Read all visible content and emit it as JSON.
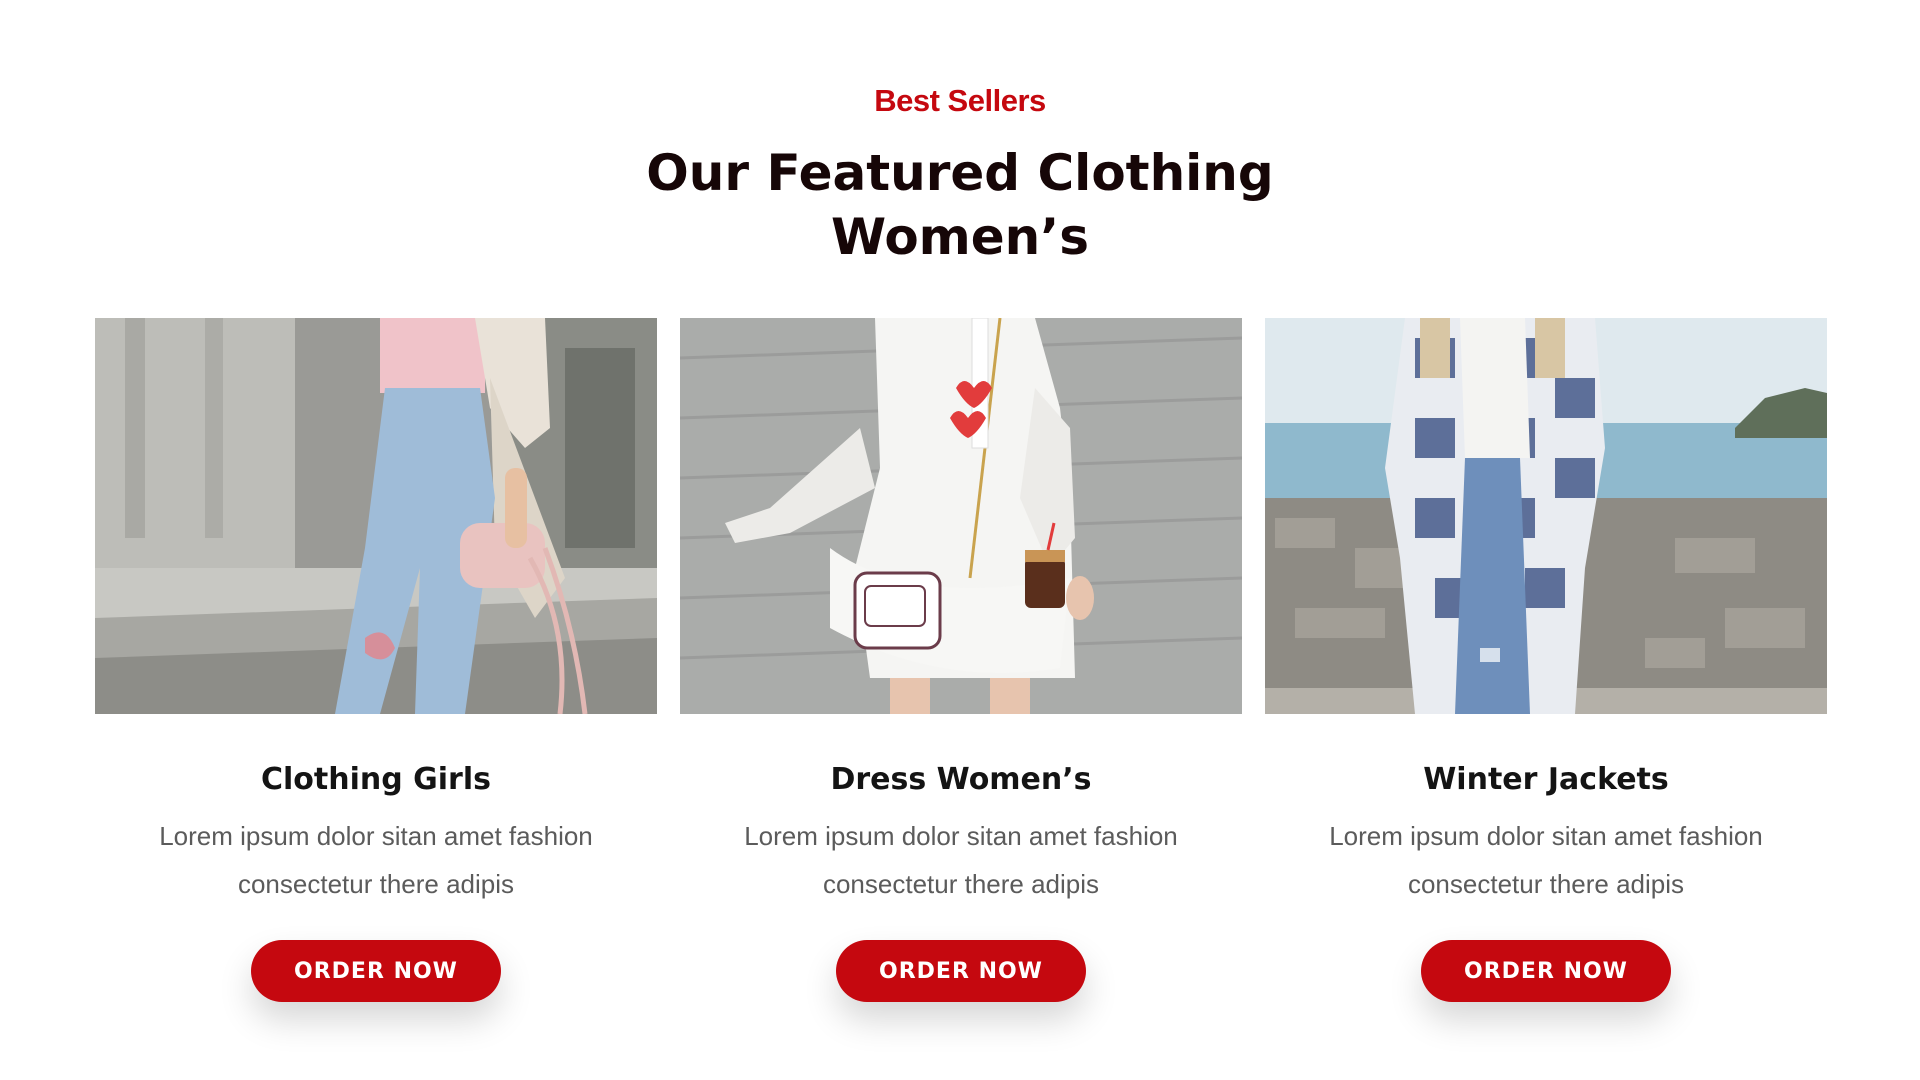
{
  "header": {
    "eyebrow": "Best Sellers",
    "title_line1": "Our Featured Clothing",
    "title_line2": "Women’s"
  },
  "colors": {
    "accent": "#c5080f",
    "heading": "#160607",
    "body_text": "#5b5b5b"
  },
  "products": [
    {
      "image": "woman-in-light-jeans-with-pink-handbag",
      "title": "Clothing Girls",
      "description": "Lorem ipsum dolor sitan amet fashion consectetur there adipis",
      "button": "ORDER NOW"
    },
    {
      "image": "woman-in-white-dress-with-heart-bag",
      "title": "Dress Women’s",
      "description": "Lorem ipsum dolor sitan amet fashion consectetur there adipis",
      "button": "ORDER NOW"
    },
    {
      "image": "woman-in-plaid-jacket-by-sea",
      "title": "Winter Jackets",
      "description": "Lorem ipsum dolor sitan amet fashion consectetur there adipis",
      "button": "ORDER NOW"
    }
  ]
}
